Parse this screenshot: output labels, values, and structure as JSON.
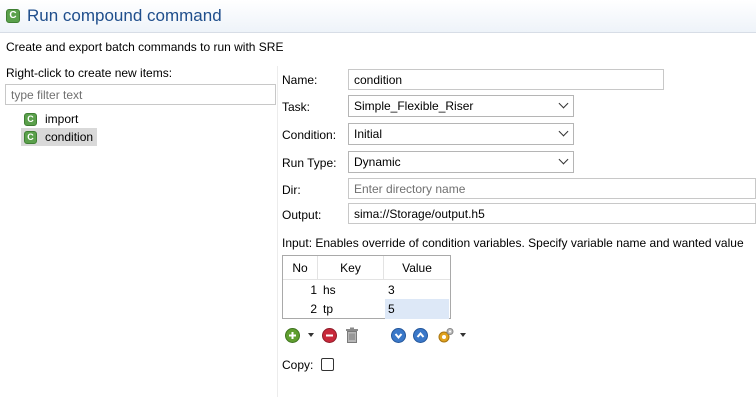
{
  "header": {
    "title": "Run compound command",
    "icon": "compound-command-icon"
  },
  "subtitle": "Create and export batch commands to run with SRE",
  "left": {
    "label": "Right-click to create new items:",
    "filter_placeholder": "type filter text",
    "items": [
      {
        "label": "import",
        "icon": "command-icon",
        "selected": false
      },
      {
        "label": "condition",
        "icon": "command-icon",
        "selected": true
      }
    ]
  },
  "form": {
    "name_label": "Name:",
    "name_value": "condition",
    "task_label": "Task:",
    "task_value": "Simple_Flexible_Riser",
    "condition_label": "Condition:",
    "condition_value": "Initial",
    "runtype_label": "Run Type:",
    "runtype_value": "Dynamic",
    "dir_label": "Dir:",
    "dir_placeholder": "Enter directory name",
    "output_label": "Output:",
    "output_value": "sima://Storage/output.h5",
    "input_desc": "Input: Enables override of condition variables. Specify variable name and wanted value",
    "copy_label": "Copy:",
    "copy_checked": false
  },
  "table": {
    "columns": [
      "No",
      "Key",
      "Value"
    ],
    "rows": [
      {
        "no": "1",
        "key": "hs",
        "value": "3"
      },
      {
        "no": "2",
        "key": "tp",
        "value": "5"
      }
    ]
  },
  "toolbar": {
    "icons": [
      "add-icon",
      "dropdown-arrow-icon",
      "remove-icon",
      "delete-icon",
      "move-down-icon",
      "move-up-icon",
      "settings-icon",
      "dropdown-arrow-icon"
    ]
  },
  "colors": {
    "accent": "#1f4e8c",
    "command_icon": "#5aa04b",
    "selection": "#d9d9d9",
    "cell_selection": "#dde8f7"
  }
}
